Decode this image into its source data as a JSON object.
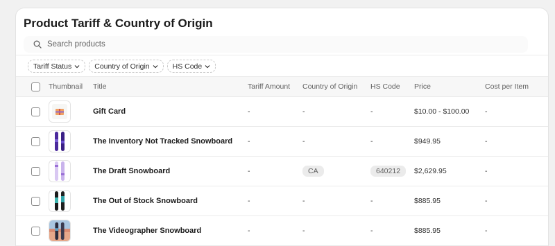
{
  "page": {
    "title": "Product Tariff & Country of Origin"
  },
  "search": {
    "placeholder": "Search products"
  },
  "filters": [
    {
      "label": "Tariff Status"
    },
    {
      "label": "Country of Origin"
    },
    {
      "label": "HS Code"
    }
  ],
  "table": {
    "columns": [
      "Thumbnail",
      "Title",
      "Tariff Amount",
      "Country of Origin",
      "HS Code",
      "Price",
      "Cost per Item"
    ],
    "rows": [
      {
        "title": "Gift Card",
        "tariff": "-",
        "country": "-",
        "hs": "-",
        "price": "$10.00 - $100.00",
        "cost": "-",
        "thumb": "gift-card-icon"
      },
      {
        "title": "The Inventory Not Tracked Snowboard",
        "tariff": "-",
        "country": "-",
        "hs": "-",
        "price": "$949.95",
        "cost": "-",
        "thumb": "snowboard-purple-icon"
      },
      {
        "title": "The Draft Snowboard",
        "tariff": "-",
        "country": "CA",
        "hs": "640212",
        "price": "$2,629.95",
        "cost": "-",
        "thumb": "snowboard-lavender-icon"
      },
      {
        "title": "The Out of Stock Snowboard",
        "tariff": "-",
        "country": "-",
        "hs": "-",
        "price": "$885.95",
        "cost": "-",
        "thumb": "snowboard-teal-icon"
      },
      {
        "title": "The Videographer Snowboard",
        "tariff": "-",
        "country": "-",
        "hs": "-",
        "price": "$885.95",
        "cost": "-",
        "thumb": "snowboard-photo-icon"
      }
    ]
  }
}
